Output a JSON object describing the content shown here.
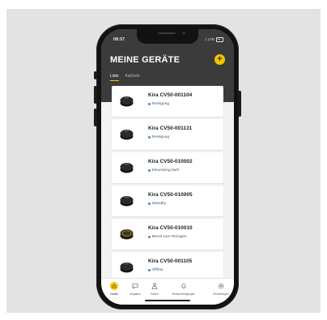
{
  "status_bar": {
    "time": "08:57",
    "signal": "..l",
    "network": "LTE"
  },
  "header": {
    "title": "MEINE GERÄTE",
    "add_label": "+",
    "tabs": [
      {
        "label": "Liste",
        "active": true
      },
      {
        "label": "Kacheln",
        "active": false
      }
    ]
  },
  "devices": [
    {
      "name": "Kira CV50-001104",
      "status": "Reinigung",
      "status_color": "#3b8ee6",
      "robot_color": "#2a2a2a"
    },
    {
      "name": "Kira CV50-001131",
      "status": "Reinigung",
      "status_color": "#3b8ee6",
      "robot_color": "#2a2a2a"
    },
    {
      "name": "Kira CV50-010002",
      "status": "Erkundung läuft",
      "status_color": "#3b8ee6",
      "robot_color": "#2a2a2a"
    },
    {
      "name": "Kira CV50-010005",
      "status": "Standby",
      "status_color": "#3b8ee6",
      "robot_color": "#2a2a2a"
    },
    {
      "name": "Kira CV50-010010",
      "status": "Bereit zum Reinigen",
      "status_color": "#4caf50",
      "robot_color": "#3a3520"
    },
    {
      "name": "Kira CV50-001105",
      "status": "Offline",
      "status_color": "#3b8ee6",
      "robot_color": "#2a2a2a"
    }
  ],
  "bottom_nav": [
    {
      "label": "Geräte",
      "icon": "home-icon",
      "active": true
    },
    {
      "label": "Aufgaben",
      "icon": "chat-icon",
      "active": false
    },
    {
      "label": "Karten",
      "icon": "map-icon",
      "active": false
    },
    {
      "label": "Benachrichtigungen",
      "icon": "bell-icon",
      "active": false
    },
    {
      "label": "Einstellungen",
      "icon": "gear-icon",
      "active": false
    }
  ],
  "colors": {
    "accent": "#f5c400",
    "header_bg": "#3b3b3b",
    "list_bg": "#f2f2f2"
  }
}
